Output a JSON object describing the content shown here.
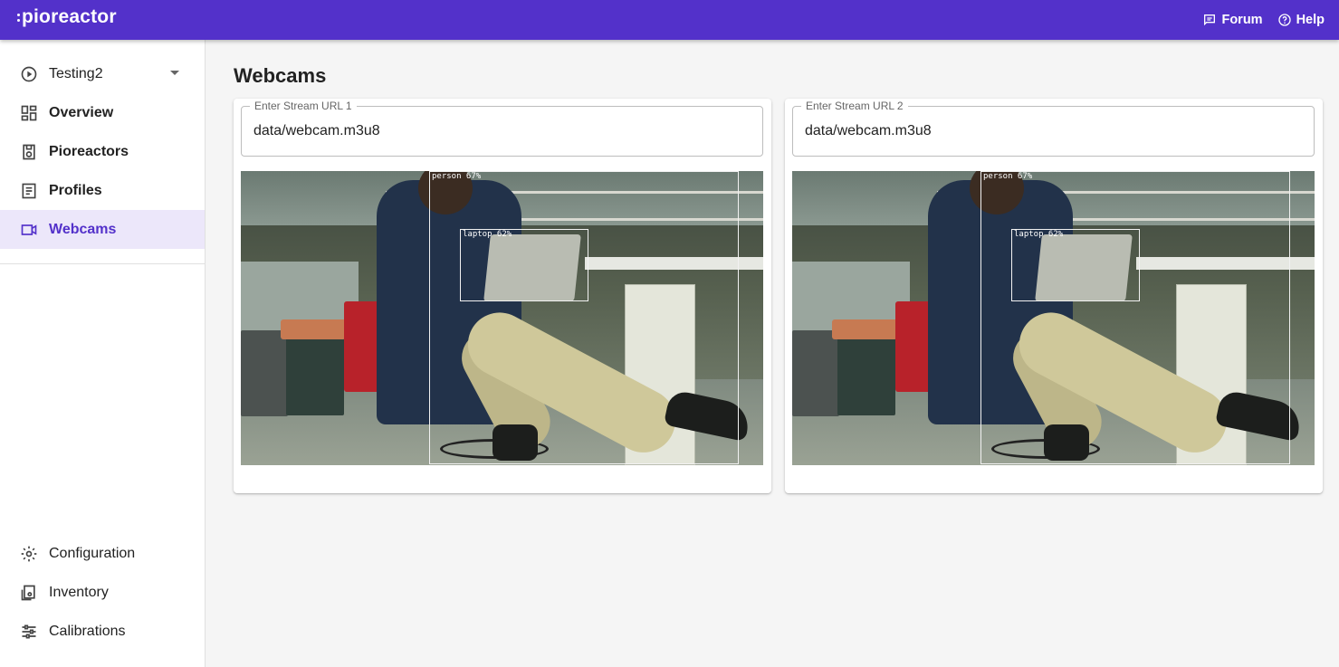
{
  "header": {
    "logo": "pioreactor",
    "links": [
      {
        "label": "Forum",
        "icon": "forum-icon"
      },
      {
        "label": "Help",
        "icon": "help-icon"
      }
    ]
  },
  "sidebar": {
    "experiment": "Testing2",
    "items": [
      {
        "label": "Overview",
        "icon": "dashboard-icon"
      },
      {
        "label": "Pioreactors",
        "icon": "pioreactor-icon"
      },
      {
        "label": "Profiles",
        "icon": "profile-icon"
      },
      {
        "label": "Webcams",
        "icon": "webcam-icon",
        "active": true
      }
    ],
    "bottom_items": [
      {
        "label": "Configuration",
        "icon": "gear-icon"
      },
      {
        "label": "Inventory",
        "icon": "inventory-icon"
      },
      {
        "label": "Calibrations",
        "icon": "sliders-icon"
      }
    ]
  },
  "main": {
    "title": "Webcams",
    "cards": [
      {
        "field_label": "Enter Stream URL 1",
        "value": "data/webcam.m3u8",
        "detections": [
          {
            "label": "person 67%"
          },
          {
            "label": "laptop 62%"
          }
        ]
      },
      {
        "field_label": "Enter Stream URL 2",
        "value": "data/webcam.m3u8",
        "detections": [
          {
            "label": "person 67%"
          },
          {
            "label": "laptop 62%"
          }
        ]
      }
    ]
  },
  "colors": {
    "brand": "#5331ca",
    "active_bg": "#ece7fa"
  }
}
